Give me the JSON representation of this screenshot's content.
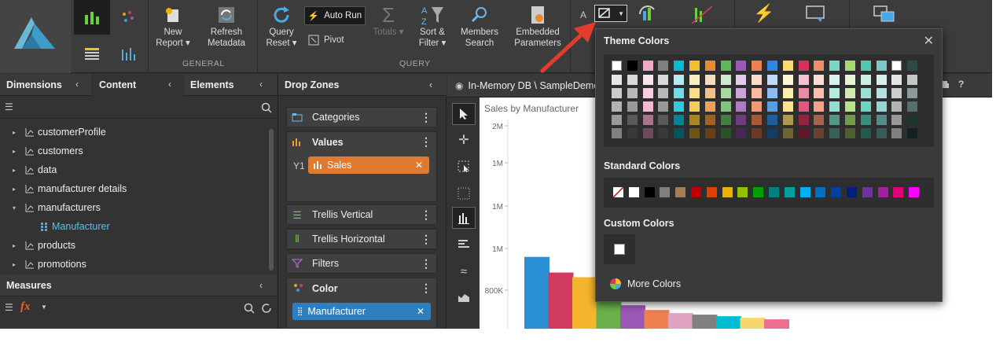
{
  "ribbon": {
    "new_report": "New\nReport ▾",
    "refresh_metadata": "Refresh\nMetadata",
    "group_general": "GENERAL",
    "query_reset": "Query\nReset ▾",
    "auto_run": "Auto Run",
    "pivot": "Pivot",
    "totals": "Totals ▾",
    "sort_filter": "Sort &\nFilter ▾",
    "members_search": "Members\nSearch",
    "embedded_parameters": "Embedded\nParameters",
    "group_query": "QUERY",
    "font_size_glyph": "A"
  },
  "left_panel": {
    "tabs": [
      "Dimensions",
      "Content",
      "Elements"
    ],
    "tree": [
      {
        "label": "customerProfile",
        "caret": "▸",
        "child": false
      },
      {
        "label": "customers",
        "caret": "▸",
        "child": false
      },
      {
        "label": "data",
        "caret": "▸",
        "child": false
      },
      {
        "label": "manufacturer details",
        "caret": "▸",
        "child": false
      },
      {
        "label": "manufacturers",
        "caret": "▾",
        "child": false
      },
      {
        "label": "Manufacturer",
        "caret": "",
        "child": true
      },
      {
        "label": "products",
        "caret": "▸",
        "child": false
      },
      {
        "label": "promotions",
        "caret": "▸",
        "child": false
      }
    ],
    "measures_title": "Measures",
    "fx": "fx"
  },
  "drop_zones": {
    "title": "Drop Zones",
    "categories": "Categories",
    "values": "Values",
    "y_label": "Y1",
    "sales_pill": "Sales",
    "trellis_vertical": "Trellis Vertical",
    "trellis_horizontal": "Trellis Horizontal",
    "filters": "Filters",
    "color": "Color",
    "manufacturer_pill": "Manufacturer"
  },
  "breadcrumb": "In-Memory DB \\ SampleDemo",
  "color_picker": {
    "theme_title": "Theme Colors",
    "standard_title": "Standard Colors",
    "custom_title": "Custom Colors",
    "more_colors": "More Colors",
    "theme_top": [
      "#ffffff",
      "#000000",
      "#f0a8c8",
      "#7f7f7f",
      "#00bcd4",
      "#f0c030",
      "#e88a30",
      "#5cb85c",
      "#9b59b6",
      "#f08050",
      "#2e86de",
      "#f7dc6f",
      "#d63060",
      "#f38b6d",
      "#77d8c8",
      "#a8d870",
      "#4ec9b0",
      "#7cc8c8",
      "#ffffff",
      "#2e4a48"
    ],
    "standard": [
      "none",
      "#ffffff",
      "#000000",
      "#7f7f7f",
      "#a67c52",
      "#c00000",
      "#e04000",
      "#f0b000",
      "#90c000",
      "#00a000",
      "#008080",
      "#00a0a0",
      "#00b0f0",
      "#0070c0",
      "#0040a0",
      "#002080",
      "#7030a0",
      "#a020a0",
      "#e0007a",
      "#ff00ff"
    ]
  },
  "chart_data": {
    "type": "bar",
    "title": "Sales by Manufacturer",
    "y_ticks": [
      "2M",
      "1M",
      "1M",
      "1M",
      "800K"
    ],
    "series_colors": [
      "#2b8fd6",
      "#d03a5e",
      "#f5b52e",
      "#6ab04c",
      "#9b59b6",
      "#f08050",
      "#e0a4c0",
      "#808080",
      "#00bcd4",
      "#f5d76e",
      "#ee6e8e"
    ],
    "values": [
      1160000,
      1060000,
      1030000,
      910000,
      850000,
      820000,
      800000,
      790000,
      780000,
      770000,
      760000
    ],
    "ylim": [
      700000,
      2000000
    ]
  }
}
